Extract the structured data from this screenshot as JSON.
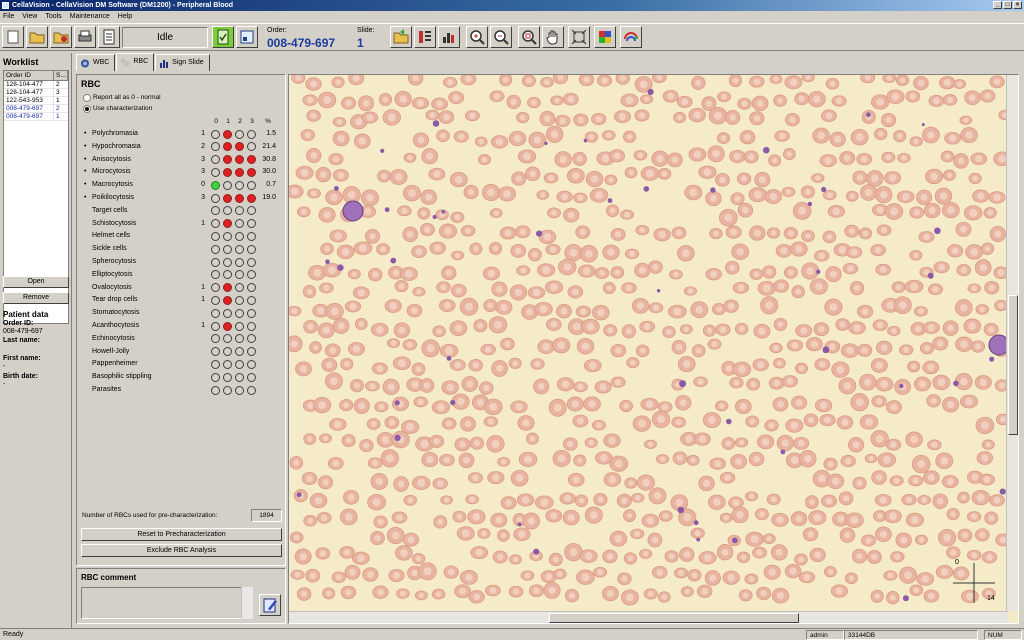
{
  "window": {
    "title": "CellaVision - CellaVision DM Software (DM1200) - Peripheral Blood"
  },
  "menu": [
    "File",
    "View",
    "Tools",
    "Maintenance",
    "Help"
  ],
  "toolbar": {
    "status": "Idle",
    "order_label": "Order:",
    "order_value": "008-479-697",
    "slide_label": "Slide:",
    "slide_value": "1"
  },
  "worklist": {
    "title": "Worklist",
    "columns": [
      "Order ID",
      "S..."
    ],
    "rows": [
      {
        "order": "128-104-477",
        "s": "2"
      },
      {
        "order": "128-104-477",
        "s": "3"
      },
      {
        "order": "122-543-953",
        "s": "1"
      },
      {
        "order": "008-479-697",
        "s": "2"
      },
      {
        "order": "008-479-697",
        "s": "1"
      }
    ],
    "open_label": "Open",
    "remove_label": "Remove"
  },
  "patient": {
    "title": "Patient data",
    "order_id_label": "Order ID:",
    "order_id_value": "008-479-697",
    "last_name_label": "Last name:",
    "last_name_value": "",
    "first_name_label": "First name:",
    "first_name_value": "-",
    "birth_date_label": "Birth date:",
    "birth_date_value": "-"
  },
  "tabs": [
    {
      "label": "WBC",
      "active": false
    },
    {
      "label": "RBC",
      "active": true
    },
    {
      "label": "Sign Slide",
      "active": false
    }
  ],
  "rbc": {
    "title": "RBC",
    "option_report_normal": "Report all as 0 - normal",
    "option_use_char": "Use characterization",
    "col_headers": [
      "0",
      "1",
      "2",
      "3",
      "%"
    ],
    "characteristics": [
      {
        "name": "Polychromasia",
        "bullet": true,
        "level": "1",
        "dots": [
          0,
          1,
          0,
          0
        ],
        "pct": "1.5"
      },
      {
        "name": "Hypochromasia",
        "bullet": true,
        "level": "2",
        "dots": [
          0,
          1,
          1,
          0
        ],
        "pct": "21.4"
      },
      {
        "name": "Anisocytosis",
        "bullet": true,
        "level": "3",
        "dots": [
          0,
          1,
          1,
          1
        ],
        "pct": "30.8"
      },
      {
        "name": "Microcytosis",
        "bullet": true,
        "level": "3",
        "dots": [
          0,
          1,
          1,
          1
        ],
        "pct": "30.0"
      },
      {
        "name": "Macrocytosis",
        "bullet": true,
        "level": "0",
        "dots": [
          2,
          0,
          0,
          0
        ],
        "pct": "0.7"
      },
      {
        "name": "Poikilocytosis",
        "bullet": true,
        "level": "3",
        "dots": [
          0,
          1,
          1,
          1
        ],
        "pct": "19.0"
      },
      {
        "name": "Target cells",
        "bullet": false,
        "level": "",
        "dots": [
          0,
          0,
          0,
          0
        ],
        "pct": ""
      },
      {
        "name": "Schistocytosis",
        "bullet": false,
        "level": "1",
        "dots": [
          0,
          1,
          0,
          0
        ],
        "pct": ""
      },
      {
        "name": "Helmet cells",
        "bullet": false,
        "level": "",
        "dots": [
          0,
          0,
          0,
          0
        ],
        "pct": ""
      },
      {
        "name": "Sickle cells",
        "bullet": false,
        "level": "",
        "dots": [
          0,
          0,
          0,
          0
        ],
        "pct": ""
      },
      {
        "name": "Spherocytosis",
        "bullet": false,
        "level": "",
        "dots": [
          0,
          0,
          0,
          0
        ],
        "pct": ""
      },
      {
        "name": "Elliptocytosis",
        "bullet": false,
        "level": "",
        "dots": [
          0,
          0,
          0,
          0
        ],
        "pct": ""
      },
      {
        "name": "Ovalocytosis",
        "bullet": false,
        "level": "1",
        "dots": [
          0,
          1,
          0,
          0
        ],
        "pct": ""
      },
      {
        "name": "Tear drop cells",
        "bullet": false,
        "level": "1",
        "dots": [
          0,
          1,
          0,
          0
        ],
        "pct": ""
      },
      {
        "name": "Stomatocytosis",
        "bullet": false,
        "level": "",
        "dots": [
          0,
          0,
          0,
          0
        ],
        "pct": ""
      },
      {
        "name": "Acanthocytosis",
        "bullet": false,
        "level": "1",
        "dots": [
          0,
          1,
          0,
          0
        ],
        "pct": ""
      },
      {
        "name": "Echinocytosis",
        "bullet": false,
        "level": "",
        "dots": [
          0,
          0,
          0,
          0
        ],
        "pct": ""
      },
      {
        "name": "Howell-Jolly",
        "bullet": false,
        "level": "",
        "dots": [
          0,
          0,
          0,
          0
        ],
        "pct": ""
      },
      {
        "name": "Pappenheimer",
        "bullet": false,
        "level": "",
        "dots": [
          0,
          0,
          0,
          0
        ],
        "pct": ""
      },
      {
        "name": "Basophilic stippling",
        "bullet": false,
        "level": "",
        "dots": [
          0,
          0,
          0,
          0
        ],
        "pct": ""
      },
      {
        "name": "Parasites",
        "bullet": false,
        "level": "",
        "dots": [
          0,
          0,
          0,
          0
        ],
        "pct": ""
      }
    ],
    "precount_label": "Number of RBCs used for pre-characterization:",
    "precount_value": "1894",
    "reset_label": "Reset to Precharacterization",
    "exclude_label": "Exclude RBC Analysis",
    "comment_title": "RBC comment"
  },
  "viewer": {
    "scale_top": "0",
    "scale_bottom": "14"
  },
  "statusbar": {
    "ready": "Ready",
    "user": "admin",
    "machine": "33144DB",
    "num": "NUM"
  },
  "colors": {
    "accent": "#1a3c9c",
    "dot_red": "#e02020",
    "dot_green": "#40d040",
    "smear_bg": "#f6ebc8",
    "rbc_fill": "#e8b4a0"
  }
}
